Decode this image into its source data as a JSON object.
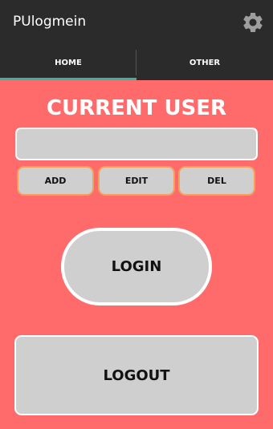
{
  "action_bar": {
    "title": "PUlogmein",
    "settings_icon": "gear-icon"
  },
  "tabs": [
    {
      "label": "HOME",
      "selected": true
    },
    {
      "label": "OTHER",
      "selected": false
    }
  ],
  "main": {
    "section_title": "CURRENT USER",
    "current_user_value": "",
    "buttons": {
      "add": "ADD",
      "edit": "EDIT",
      "del": "DEL",
      "login": "LOGIN",
      "logout": "LOGOUT"
    }
  },
  "colors": {
    "background": "#ff6b6b",
    "action_bar": "#2b2b2b",
    "tab_indicator": "#33b5a5",
    "button_fill": "#cfcfcf"
  }
}
